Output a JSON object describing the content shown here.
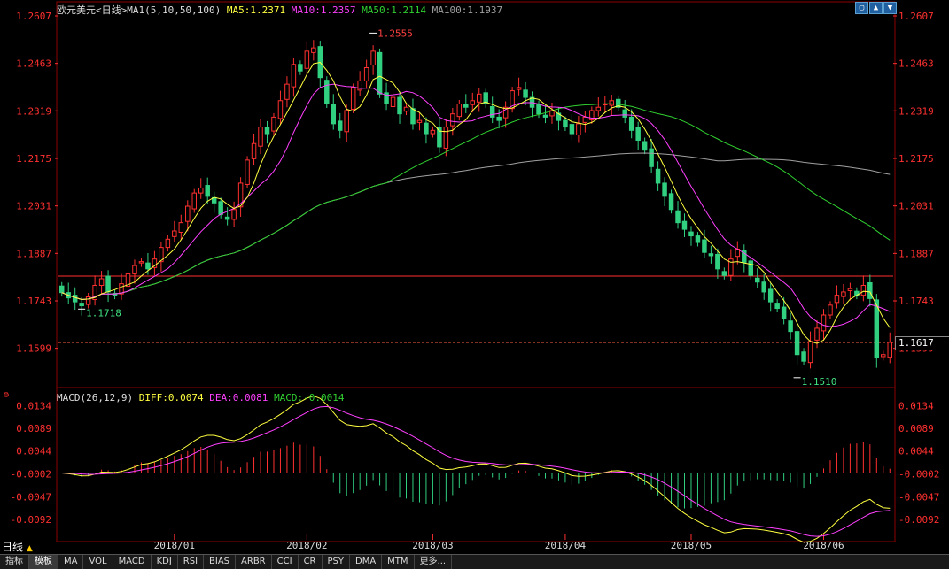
{
  "header": {
    "symbol": "欧元美元<日线>",
    "ma_label": "MA1(5,10,50,100)",
    "ma5": "MA5:1.2371",
    "ma10": "MA10:1.2357",
    "ma50": "MA50:1.2114",
    "ma100": "MA100:1.1937"
  },
  "macd_header": {
    "label": "MACD(26,12,9)",
    "diff": "DIFF:0.0074",
    "dea": "DEA:0.0081",
    "macd": "MACD:-0.0014"
  },
  "current_price": "1.1617",
  "period_label": "日线",
  "bottom_tabs": [
    "指标",
    "模板",
    "MA",
    "VOL",
    "MACD",
    "KDJ",
    "RSI",
    "BIAS",
    "ARBR",
    "CCI",
    "CR",
    "PSY",
    "DMA",
    "MTM",
    "更多..."
  ],
  "colors": {
    "up": "#ff3030",
    "down": "#30d080",
    "ma5": "#ffff40",
    "ma10": "#ff40ff",
    "ma50": "#30d030",
    "ma100": "#a0a0a0",
    "axis": "#ff3030"
  },
  "chart_data": [
    {
      "type": "candlestick",
      "title": "欧元美元<日线>",
      "ylim": [
        1.148,
        1.2607
      ],
      "y_ticks": [
        "1.2607",
        "1.2463",
        "1.2319",
        "1.2175",
        "1.2031",
        "1.1887",
        "1.1743",
        "1.1599"
      ],
      "x_ticks": [
        "2018/01",
        "2018/02",
        "2018/03",
        "2018/04",
        "2018/05",
        "2018/06"
      ],
      "x_tick_index": [
        17,
        37,
        56,
        76,
        95,
        115
      ],
      "annotations": [
        {
          "text": "1.2555",
          "index": 47,
          "value": 1.2555
        },
        {
          "text": "1.1718",
          "index": 3,
          "value": 1.1718
        },
        {
          "text": "1.1510",
          "index": 111,
          "value": 1.151
        }
      ],
      "horizontal_line": 1.1818,
      "last_price_line": 1.1617,
      "close": [
        1.1768,
        1.1752,
        1.174,
        1.1728,
        1.1755,
        1.179,
        1.181,
        1.177,
        1.176,
        1.1795,
        1.1825,
        1.185,
        1.1862,
        1.184,
        1.187,
        1.1905,
        1.193,
        1.1955,
        1.198,
        1.203,
        1.207,
        1.2085,
        1.206,
        1.204,
        1.2005,
        1.199,
        1.202,
        1.21,
        1.217,
        1.222,
        1.227,
        1.225,
        1.23,
        1.235,
        1.24,
        1.246,
        1.244,
        1.25,
        1.251,
        1.242,
        1.234,
        1.228,
        1.226,
        1.232,
        1.239,
        1.241,
        1.245,
        1.25,
        1.237,
        1.234,
        1.236,
        1.231,
        1.233,
        1.228,
        1.229,
        1.225,
        1.226,
        1.221,
        1.227,
        1.231,
        1.234,
        1.233,
        1.235,
        1.237,
        1.234,
        1.23,
        1.229,
        1.233,
        1.238,
        1.239,
        1.236,
        1.233,
        1.231,
        1.23,
        1.232,
        1.229,
        1.227,
        1.225,
        1.228,
        1.23,
        1.232,
        1.233,
        1.234,
        1.235,
        1.233,
        1.23,
        1.226,
        1.223,
        1.22,
        1.215,
        1.21,
        1.206,
        1.202,
        1.198,
        1.196,
        1.194,
        1.192,
        1.189,
        1.188,
        1.184,
        1.182,
        1.187,
        1.19,
        1.186,
        1.182,
        1.18,
        1.177,
        1.174,
        1.172,
        1.169,
        1.165,
        1.158,
        1.156,
        1.162,
        1.166,
        1.17,
        1.173,
        1.176,
        1.177,
        1.178,
        1.176,
        1.179,
        1.175,
        1.157,
        1.158,
        1.1617
      ],
      "series": [
        {
          "name": "MA5",
          "values": []
        },
        {
          "name": "MA10",
          "values": []
        },
        {
          "name": "MA50",
          "values": []
        },
        {
          "name": "MA100",
          "values": []
        }
      ]
    },
    {
      "type": "macd",
      "title": "MACD(26,12,9)",
      "ylim": [
        -0.0115,
        0.0145
      ],
      "y_ticks": [
        "0.0134",
        "0.0089",
        "0.0044",
        "-0.0002",
        "-0.0047",
        "-0.0092"
      ]
    }
  ]
}
